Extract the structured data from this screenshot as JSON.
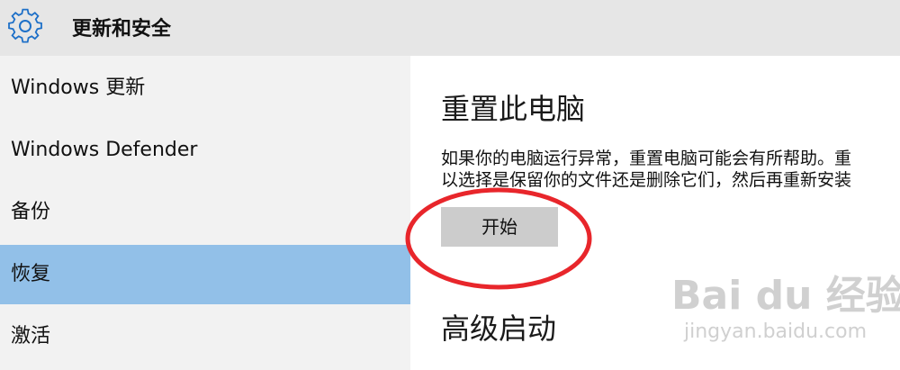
{
  "header": {
    "title": "更新和安全",
    "icon": "gear-icon"
  },
  "sidebar": {
    "items": [
      {
        "label": "Windows 更新",
        "active": false
      },
      {
        "label": "Windows Defender",
        "active": false
      },
      {
        "label": "备份",
        "active": false
      },
      {
        "label": "恢复",
        "active": true
      },
      {
        "label": "激活",
        "active": false
      }
    ]
  },
  "main": {
    "reset_title": "重置此电脑",
    "reset_desc_line1": "如果你的电脑运行异常，重置电脑可能会有所帮助。重",
    "reset_desc_line2": "以选择是保留你的文件还是删除它们，然后再重新安装",
    "start_button": "开始",
    "advanced_title": "高级启动"
  },
  "watermark": {
    "logo": "Bai du 经验",
    "sub": "jingyan.baidu.com"
  },
  "colors": {
    "header_bg": "#e6e6e6",
    "sidebar_bg": "#f2f2f2",
    "active_item_bg": "#92c0e8",
    "icon_blue": "#1e70c8",
    "annotation_red": "#e8262b",
    "button_bg": "#cccccc"
  }
}
